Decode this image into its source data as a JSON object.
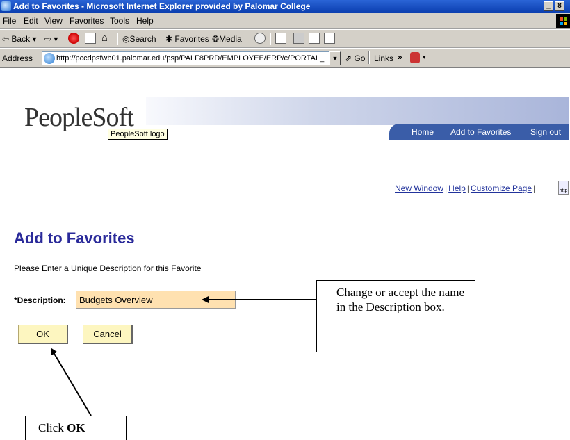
{
  "window": {
    "title": "Add to Favorites - Microsoft Internet Explorer provided by Palomar College",
    "minimize_glyph": "_",
    "restore_glyph": "8"
  },
  "menu": [
    "File",
    "Edit",
    "View",
    "Favorites",
    "Tools",
    "Help"
  ],
  "toolbar": {
    "back": "Back",
    "search": "Search",
    "favorites": "Favorites",
    "media": "Media"
  },
  "address": {
    "label": "Address",
    "url": "http://pccdpsfwb01.palomar.edu/psp/PALF8PRD/EMPLOYEE/ERP/c/PORTAL_",
    "go": "Go",
    "links": "Links",
    "chevron": "»"
  },
  "header": {
    "logo": "PeopleSoft",
    "tooltip": "PeopleSoft logo",
    "nav": [
      "Home",
      "Add to Favorites",
      "Sign out"
    ]
  },
  "page_links": [
    "New Window",
    "Help",
    "Customize Page"
  ],
  "http_icon_label": "http",
  "form": {
    "title": "Add to Favorites",
    "instruction": "Please Enter a Unique Description for this Favorite",
    "description_label": "*Description:",
    "description_value": "Budgets Overview",
    "ok_label": "OK",
    "cancel_label": "Cancel"
  },
  "callouts": {
    "description": "Change or accept the name in the Description box.",
    "ok_prefix": "Click ",
    "ok_bold": "OK"
  },
  "colors": {
    "title_blue": "#2a2a9a",
    "link_blue": "#22339c",
    "nav_band": "#3a5da8",
    "input_fill": "#ffe1b0",
    "button_fill": "#fdf6c0"
  }
}
